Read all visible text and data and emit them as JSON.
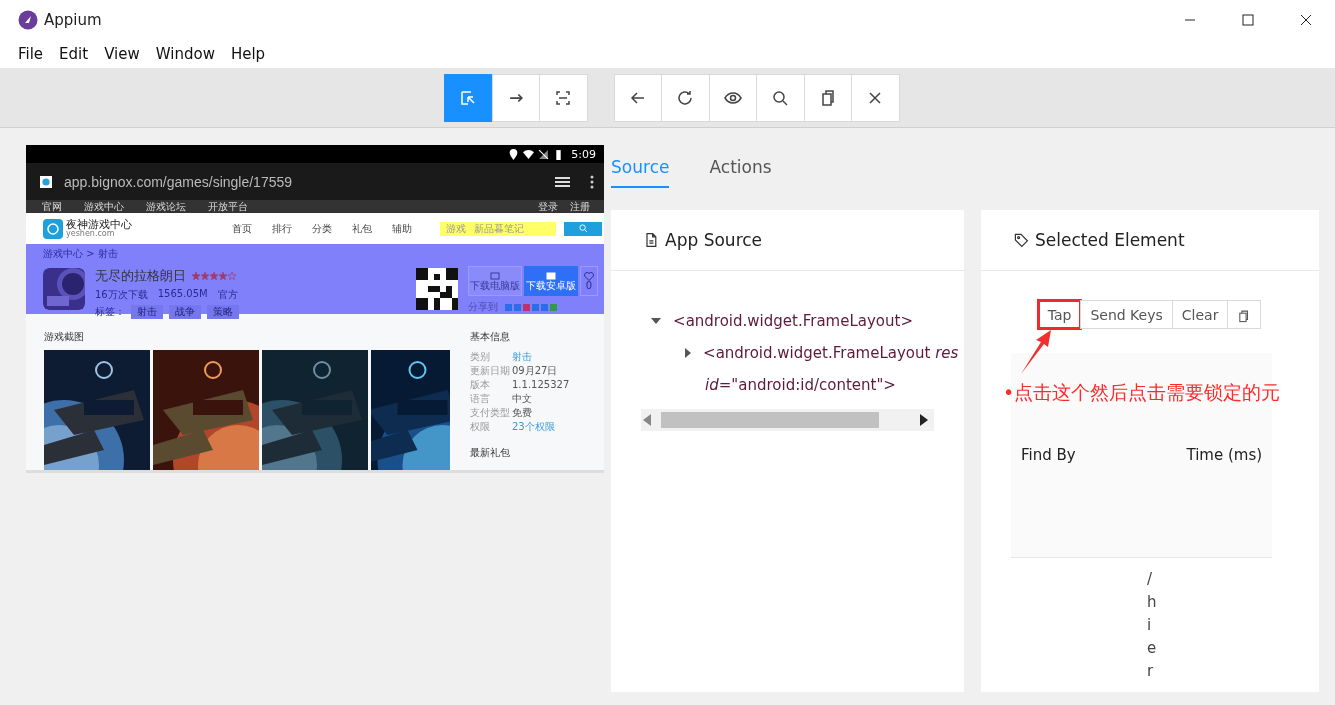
{
  "window": {
    "title": "Appium"
  },
  "menu": [
    "File",
    "Edit",
    "View",
    "Window",
    "Help"
  ],
  "mode_buttons": [
    {
      "selected": true
    },
    {
      "selected": false
    },
    {
      "selected": false
    }
  ],
  "device": {
    "time": "5:09",
    "url": "app.bignox.com/games/single/17559",
    "site_nav": [
      "官网",
      "游戏中心",
      "游戏论坛",
      "开放平台"
    ],
    "site_account": [
      "登录",
      "注册"
    ],
    "site_name": "夜神游戏中心",
    "site_domain": "yeshen.com",
    "site_menu": [
      "首页",
      "排行",
      "分类",
      "礼包",
      "辅助"
    ],
    "search_category": "游戏",
    "search_placeholder": "新品暮笔记",
    "breadcrumb": "游戏中心 > 射击",
    "game_title": "无尽的拉格朗日",
    "stars": 4,
    "meta": [
      "16万次下载",
      "1565.05M",
      "官方"
    ],
    "tags_label": "标签：",
    "tags": [
      "射击",
      "战争",
      "策略"
    ],
    "download_buttons": [
      {
        "label": "下载电脑版",
        "disabled": true
      },
      {
        "label": "下载安卓版",
        "disabled": false
      }
    ],
    "likes": "0",
    "share_label": "分享到",
    "screenshots_title": "游戏截图",
    "screenshots": [
      {
        "kind": "picture"
      },
      {
        "kind": "picture"
      },
      {
        "kind": "picture"
      },
      {
        "kind": "picture"
      }
    ],
    "info_title": "基本信息",
    "info": [
      {
        "label": "类别",
        "value": "射击",
        "link": true
      },
      {
        "label": "更新日期",
        "value": "09月27日",
        "link": false
      },
      {
        "label": "版本",
        "value": "1.1.125327",
        "link": false
      },
      {
        "label": "语言",
        "value": "中文",
        "link": false
      },
      {
        "label": "支付类型",
        "value": "免费",
        "link": false
      },
      {
        "label": "权限",
        "value": "23个权限",
        "link": true
      }
    ],
    "gift_title": "最新礼包"
  },
  "tabs": [
    {
      "label": "Source",
      "selected": true
    },
    {
      "label": "Actions",
      "selected": false
    }
  ],
  "app_source": {
    "title": "App Source",
    "tree": [
      {
        "text": "<android.widget.FrameLayout>",
        "expanded": true,
        "children": [
          {
            "text": "<android.widget.FrameLayout *res*",
            "continuation": "*id*=\"android:id/content\">",
            "expanded": false
          }
        ]
      }
    ]
  },
  "selected_element": {
    "title": "Selected Element",
    "actions": [
      "Tap",
      "Send Keys",
      "Clear"
    ],
    "columns": [
      "Find By",
      "Time (ms)"
    ],
    "vertical_text": "/hier"
  },
  "annotation": {
    "text": "•点击这个然后点击需要锁定的元"
  }
}
